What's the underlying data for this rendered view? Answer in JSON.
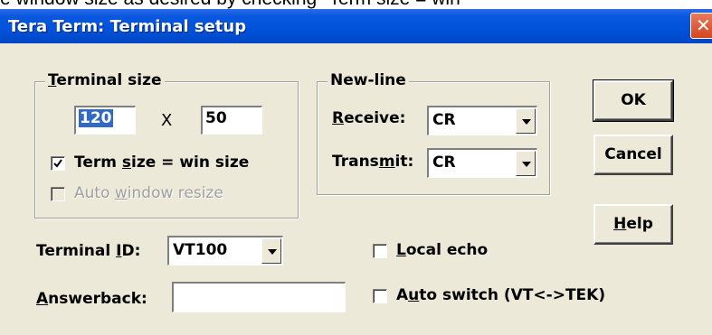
{
  "background_caption": "e window size as desired by checking \"Term size = win",
  "window": {
    "title": "Tera Term: Terminal setup"
  },
  "terminal_size": {
    "legend_prefix": "",
    "legend_accel": "T",
    "legend_rest": "erminal size",
    "columns": "120",
    "times": "X",
    "rows": "50",
    "term_size_win": {
      "checked": true,
      "pre": "Term ",
      "accel": "s",
      "post": "ize = win size"
    },
    "auto_resize": {
      "checked": false,
      "disabled": true,
      "pre": "Auto ",
      "accel": "w",
      "post": "indow resize"
    }
  },
  "newline": {
    "legend": "New-line",
    "receive": {
      "accel": "R",
      "rest": "eceive:",
      "value": "CR"
    },
    "transmit": {
      "pre": "Trans",
      "accel": "m",
      "post": "it:",
      "value": "CR"
    }
  },
  "buttons": {
    "ok": "OK",
    "cancel": "Cancel",
    "help_accel": "H",
    "help_rest": "elp"
  },
  "terminal_id": {
    "pre": "Terminal ",
    "accel": "I",
    "post": "D:",
    "value": "VT100"
  },
  "answerback": {
    "accel": "A",
    "rest": "nswerback:",
    "value": ""
  },
  "local_echo": {
    "checked": false,
    "accel": "L",
    "rest": "ocal echo"
  },
  "auto_switch": {
    "checked": false,
    "pre": "A",
    "accel": "u",
    "post": "to switch (VT<->TEK)"
  },
  "colors": {
    "titlebar": "#0052d9",
    "dialog_bg": "#ece9d8",
    "selection": "#316ac5",
    "close": "#d3461f"
  }
}
